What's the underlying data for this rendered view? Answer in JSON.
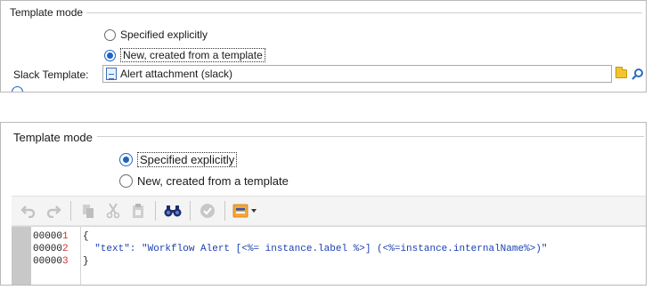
{
  "panel_top": {
    "group_title": "Template mode",
    "radio_specified_label": "Specified explicitly",
    "radio_template_label": "New, created from a template",
    "slack_label": "Slack Template:",
    "slack_value": "Alert attachment (slack)",
    "icons": [
      "document-icon",
      "folder-icon",
      "magnifier-icon"
    ]
  },
  "panel_bottom": {
    "group_title": "Template mode",
    "radio_specified_label": "Specified explicitly",
    "radio_template_label": "New, created from a template",
    "toolbar": [
      "undo-icon",
      "redo-icon",
      "paste-icon",
      "cut-icon",
      "clipboard-icon",
      "binoculars-icon",
      "check-icon",
      "insert-field-icon"
    ],
    "editor": {
      "lines": [
        {
          "number": "00000",
          "last_digit": "1",
          "text": "{"
        },
        {
          "number": "00000",
          "last_digit": "2",
          "text": "  \"text\": \"Workflow Alert [<%= instance.label %>] (<%=instance.internalName%>)\""
        },
        {
          "number": "00000",
          "last_digit": "3",
          "text": "}"
        }
      ]
    }
  },
  "colors": {
    "accent": "#1f64c4",
    "string": "#1a3fb0",
    "line_number_last": "#d03030",
    "gutter": "#c8c8c8",
    "toolbar_bg": "#f4f4f4",
    "folder": "#f4c430"
  }
}
